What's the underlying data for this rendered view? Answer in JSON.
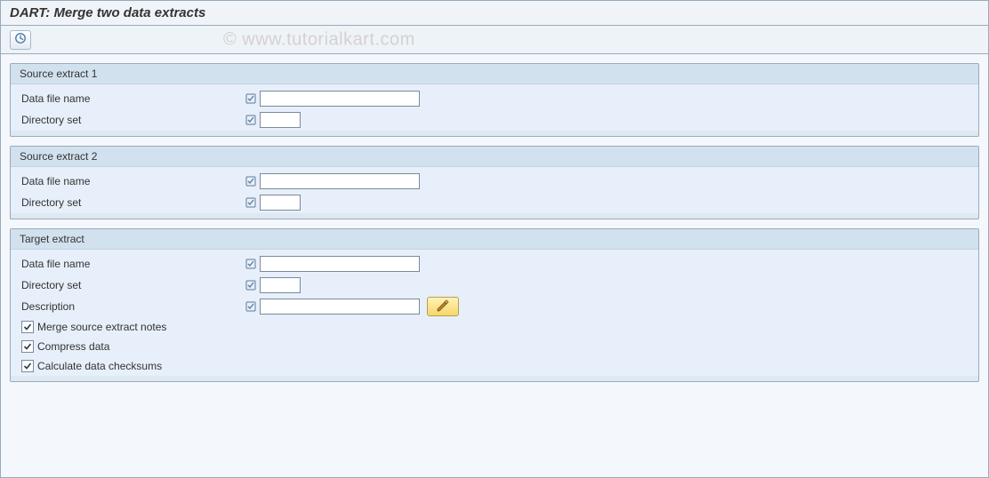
{
  "window": {
    "title": "DART: Merge two data extracts"
  },
  "watermark": "© www.tutorialkart.com",
  "sections": {
    "source1": {
      "legend": "Source extract 1",
      "data_file_label": "Data file name",
      "data_file_value": "",
      "directory_label": "Directory set",
      "directory_value": ""
    },
    "source2": {
      "legend": "Source extract 2",
      "data_file_label": "Data file name",
      "data_file_value": "",
      "directory_label": "Directory set",
      "directory_value": ""
    },
    "target": {
      "legend": "Target extract",
      "data_file_label": "Data file name",
      "data_file_value": "",
      "directory_label": "Directory set",
      "directory_value": "",
      "description_label": "Description",
      "description_value": "",
      "merge_notes_label": "Merge source extract notes",
      "compress_label": "Compress data",
      "checksums_label": "Calculate data checksums"
    }
  }
}
